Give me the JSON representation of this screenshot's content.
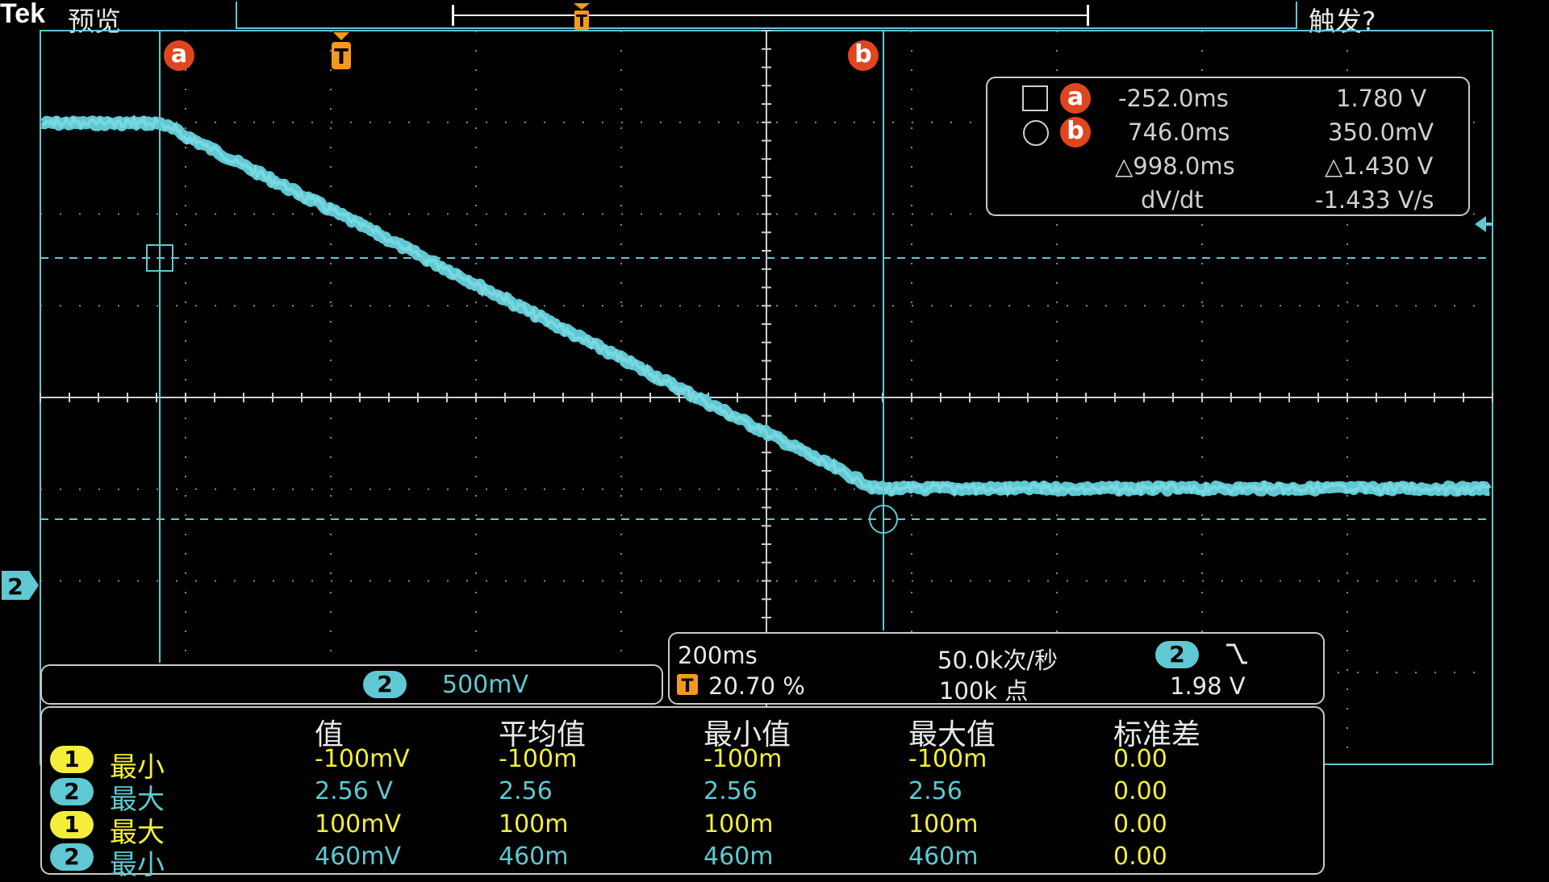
{
  "header": {
    "brand": "Tek",
    "mode": "预览",
    "trigger_status": "触发?"
  },
  "colors": {
    "channel2": "#5fc8d2",
    "channel1": "#f4ee3a",
    "trigger": "#f39a1e",
    "cursor_marker": "#e0461e"
  },
  "cursors": {
    "a_label": "a",
    "b_label": "b",
    "trigger_label": "T",
    "a_time": "-252.0ms",
    "a_value": "1.780 V",
    "b_time": "746.0ms",
    "b_value": "350.0mV",
    "delta_time": "△998.0ms",
    "delta_value": "△1.430 V",
    "dvdt_label": "dV/dt",
    "dvdt_value": "-1.433 V/s",
    "a_symbol_icon": "square-icon",
    "b_symbol_icon": "circle-icon"
  },
  "channel_marker": "2",
  "vertical": {
    "channel": "2",
    "scale": "500mV"
  },
  "horizontal": {
    "timebase": "200ms",
    "trigger_icon_label": "T",
    "trigger_position": "20.70 %",
    "sample_rate": "50.0k次/秒",
    "record_length": "100k 点",
    "trigger_channel": "2",
    "trigger_slope_icon": "falling-edge-icon",
    "trigger_level": "1.98 V"
  },
  "measurements": {
    "headers": [
      "值",
      "平均值",
      "最小值",
      "最大值",
      "标准差"
    ],
    "rows": [
      {
        "channel": "1",
        "name": "最小",
        "value": "-100mV",
        "mean": "-100m",
        "min": "-100m",
        "max": "-100m",
        "std": "0.00"
      },
      {
        "channel": "2",
        "name": "最大",
        "value": "2.56 V",
        "mean": "2.56",
        "min": "2.56",
        "max": "2.56",
        "std": "0.00"
      },
      {
        "channel": "1",
        "name": "最大",
        "value": "100mV",
        "mean": "100m",
        "min": "100m",
        "max": "100m",
        "std": "0.00"
      },
      {
        "channel": "2",
        "name": "最小",
        "value": "460mV",
        "mean": "460m",
        "min": "460m",
        "max": "460m",
        "std": "0.00"
      }
    ]
  }
}
